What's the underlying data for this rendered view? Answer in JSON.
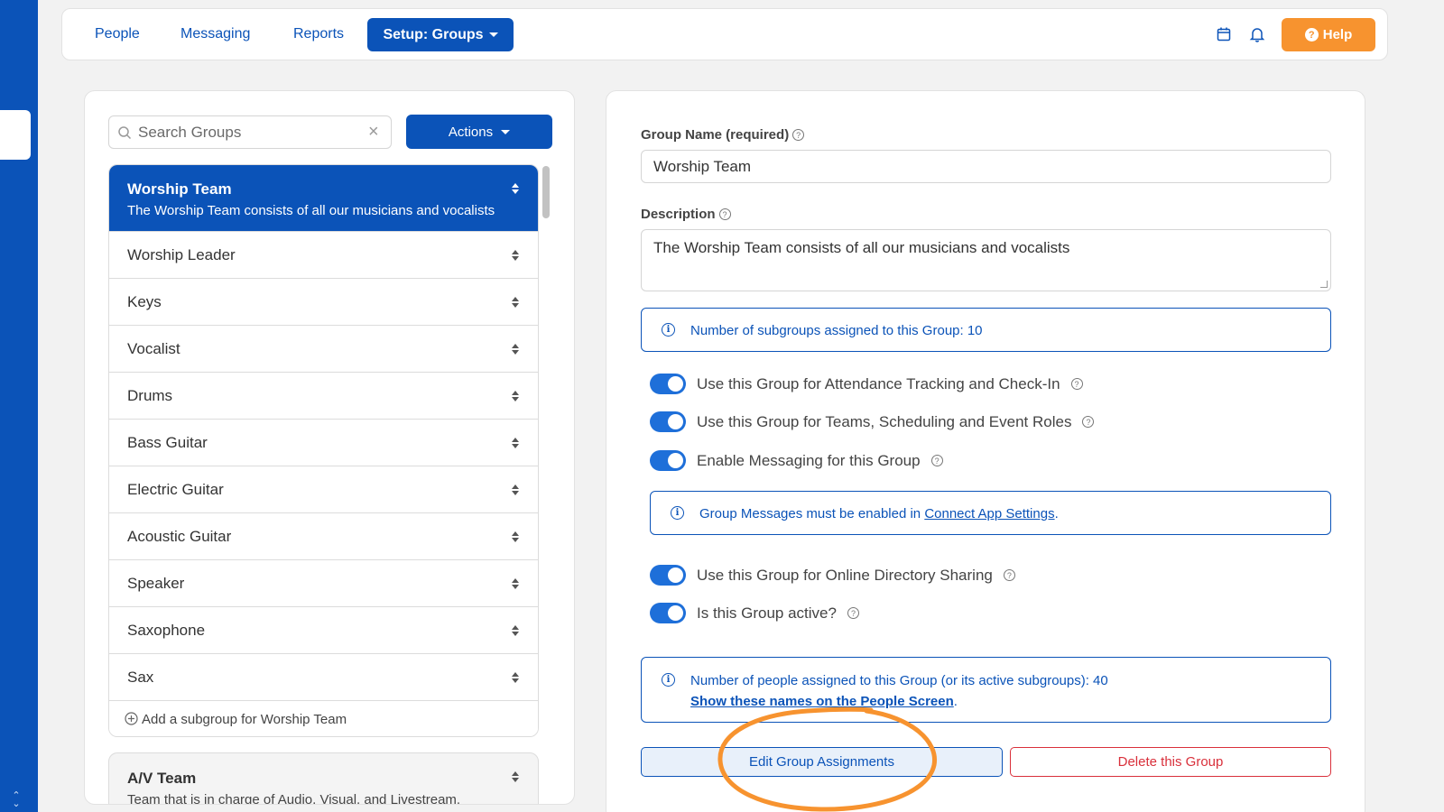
{
  "nav": {
    "people": "People",
    "messaging": "Messaging",
    "reports": "Reports",
    "setup": "Setup: Groups",
    "help": "Help"
  },
  "left": {
    "search_placeholder": "Search Groups",
    "actions": "Actions",
    "selected_group": {
      "name": "Worship Team",
      "description": "The Worship Team consists of all our musicians and vocalists"
    },
    "subgroups": [
      "Worship Leader",
      "Keys",
      "Vocalist",
      "Drums",
      "Bass Guitar",
      "Electric Guitar",
      "Acoustic Guitar",
      "Speaker",
      "Saxophone",
      "Sax"
    ],
    "add_subgroup": "Add a subgroup for Worship Team",
    "next_group": {
      "name": "A/V Team",
      "description": "Team that is in charge of Audio, Visual, and Livestream."
    }
  },
  "form": {
    "name_label": "Group Name (required)",
    "name_value": "Worship Team",
    "description_label": "Description",
    "description_value": "The Worship Team consists of all our musicians and vocalists",
    "subgroups_info": "Number of subgroups assigned to this Group: 10",
    "toggles": [
      {
        "label": "Use this Group for Attendance Tracking and Check-In",
        "on": true
      },
      {
        "label": "Use this Group for Teams, Scheduling and Event Roles",
        "on": true
      },
      {
        "label": "Enable Messaging for this Group",
        "on": true
      },
      {
        "label": "Use this Group for Online Directory Sharing",
        "on": true
      },
      {
        "label": "Is this Group active?",
        "on": true
      }
    ],
    "messages_info_prefix": "Group Messages must be enabled in ",
    "messages_info_link": "Connect App Settings",
    "messages_info_suffix": ".",
    "people_info": "Number of people assigned to this Group (or its active subgroups): 40",
    "people_link": "Show these names on the People Screen",
    "people_link_suffix": ".",
    "edit_button": "Edit Group Assignments",
    "delete_button": "Delete this Group"
  },
  "colors": {
    "primary": "#0b53b8",
    "help": "#f7932f",
    "danger": "#d9303b",
    "annotation": "#f7932f"
  }
}
